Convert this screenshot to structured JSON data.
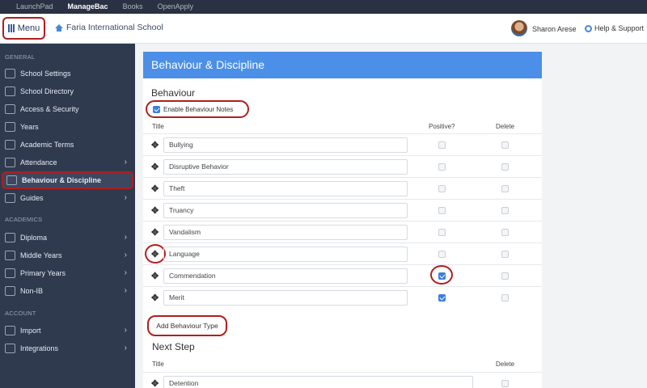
{
  "topnav": {
    "tabs": [
      "LaunchPad",
      "ManageBac",
      "Books",
      "OpenApply"
    ],
    "active_index": 1
  },
  "header": {
    "menu_label": "Menu",
    "school_name": "Faria International School",
    "user_name": "Sharon Arese",
    "help_label": "Help & Support"
  },
  "sidebar": {
    "sections": {
      "general": "GENERAL",
      "academics": "ACADEMICS",
      "account": "ACCOUNT"
    },
    "items": [
      {
        "label": "School Settings",
        "icon": "settings-icon",
        "chevron": false
      },
      {
        "label": "School Directory",
        "icon": "directory-icon",
        "chevron": false
      },
      {
        "label": "Access & Security",
        "icon": "lock-icon",
        "chevron": false
      },
      {
        "label": "Years",
        "icon": "list-icon",
        "chevron": false
      },
      {
        "label": "Academic Terms",
        "icon": "calendar-icon",
        "chevron": false
      },
      {
        "label": "Attendance",
        "icon": "attendance-icon",
        "chevron": true
      },
      {
        "label": "Behaviour & Discipline",
        "icon": "flag-icon",
        "chevron": false,
        "active": true
      },
      {
        "label": "Guides",
        "icon": "book-icon",
        "chevron": true
      },
      {
        "label": "Diploma",
        "icon": "diploma-icon",
        "chevron": true
      },
      {
        "label": "Middle Years",
        "icon": "myp-icon",
        "chevron": true
      },
      {
        "label": "Primary Years",
        "icon": "pyp-icon",
        "chevron": true
      },
      {
        "label": "Non-IB",
        "icon": "nonib-icon",
        "chevron": true
      },
      {
        "label": "Import",
        "icon": "import-icon",
        "chevron": true
      },
      {
        "label": "Integrations",
        "icon": "layers-icon",
        "chevron": true
      }
    ]
  },
  "main": {
    "title": "Behaviour & Discipline",
    "behaviour": {
      "heading": "Behaviour",
      "enable_label": "Enable Behaviour Notes",
      "enable_checked": true,
      "col_title": "Title",
      "col_positive": "Positive?",
      "col_delete": "Delete",
      "rows": [
        {
          "title": "Bullying",
          "positive": false
        },
        {
          "title": "Disruptive Behavior",
          "positive": false
        },
        {
          "title": "Theft",
          "positive": false
        },
        {
          "title": "Truancy",
          "positive": false
        },
        {
          "title": "Vandalism",
          "positive": false
        },
        {
          "title": "Language",
          "positive": false
        },
        {
          "title": "Commendation",
          "positive": true
        },
        {
          "title": "Merit",
          "positive": true
        }
      ],
      "add_button": "Add Behaviour Type"
    },
    "next_step": {
      "heading": "Next Step",
      "col_title": "Title",
      "col_delete": "Delete",
      "rows": [
        {
          "title": "Detention"
        }
      ]
    }
  },
  "colors": {
    "accent": "#4b8fe8",
    "sidebar_bg": "#2f3a4f",
    "highlight": "#b01e1e"
  }
}
